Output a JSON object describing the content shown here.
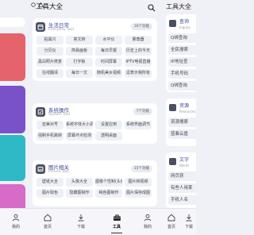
{
  "header": {
    "title": "工具大全"
  },
  "categories": [
    {
      "title": "生活日常",
      "subtitle": "EveryDay Tool",
      "count": "16个功能",
      "items": [
        "拍属只",
        "答文转",
        "水平仪",
        "量角器",
        "分贝仪",
        "简易画板",
        "每日早报",
        "历史上的今天",
        "黑白照片修复",
        "打字板",
        "时间屏幕",
        "IPTV电视直播",
        "在线翻译",
        "每日一文",
        "随机美女视频",
        "逗表示我所有"
      ]
    },
    {
      "title": "系统操作",
      "subtitle": "System Tool",
      "count": "7个功能",
      "items": [
        "亚美对号",
        "系统字体大小调节",
        "设置应用",
        "系统界面调节",
        "强制手机跳转",
        "屏幕坏点检测",
        "透明桌面"
      ]
    },
    {
      "title": "图片相关",
      "subtitle": "Picture Tool",
      "count": "15个功能",
      "items": [
        "壁纸大全",
        "头像大全",
        "图像个性制(头像)",
        "图片转视频",
        "图片取色",
        "隐藏图制作",
        "纯色图制作",
        "图片保存成图"
      ]
    }
  ],
  "right_page": {
    "title": "工具大全",
    "block1": {
      "title": "查询",
      "subtitle": "Inquiry",
      "items": [
        "Q绑查询",
        "全民搜索",
        "IP地址查",
        "手机号码",
        "Q绑查询",
        "小程序查找"
      ]
    },
    "block2": {
      "title": "资源",
      "subtitle": "Resources",
      "items": [
        "资源搜索",
        "蓝奏云盘"
      ]
    },
    "block3": {
      "title": "文字",
      "subtitle": "Words",
      "items": [
        "网页获",
        "有些人用某",
        "手机人名"
      ]
    }
  },
  "bottom_nav": [
    {
      "label": "我的",
      "icon": "user-icon",
      "active": false
    },
    {
      "label": "首页",
      "icon": "home-icon",
      "active": false
    },
    {
      "label": "下载",
      "icon": "download-icon",
      "active": false
    },
    {
      "label": "工具",
      "icon": "toolbox-icon",
      "active": true
    },
    {
      "label": "我的",
      "icon": "user-icon",
      "active": false
    },
    {
      "label": "首页",
      "icon": "home-icon",
      "active": false
    },
    {
      "label": "下载",
      "icon": "download-icon",
      "active": false
    }
  ],
  "colors": {
    "accent": "#3b4a9a",
    "icon_bg": "#4b5262",
    "background": "#f0f0f7"
  }
}
